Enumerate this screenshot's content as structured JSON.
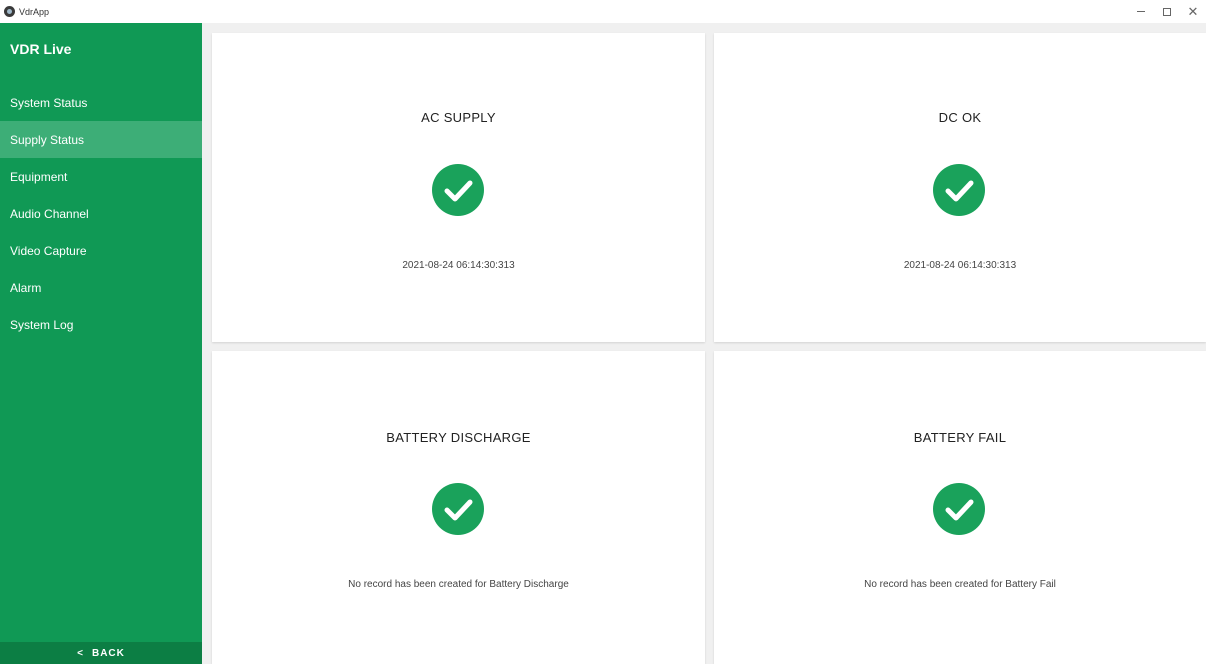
{
  "window": {
    "title": "VdrApp"
  },
  "sidebar": {
    "title": "VDR Live",
    "items": [
      {
        "label": "System Status"
      },
      {
        "label": "Supply Status"
      },
      {
        "label": "Equipment"
      },
      {
        "label": "Audio Channel"
      },
      {
        "label": "Video Capture"
      },
      {
        "label": "Alarm"
      },
      {
        "label": "System Log"
      }
    ],
    "active_item": "Supply Status",
    "back_label": "BACK"
  },
  "cards": [
    {
      "title": "AC SUPPLY",
      "status": "ok",
      "text": "2021-08-24 06:14:30:313"
    },
    {
      "title": "DC OK",
      "status": "ok",
      "text": "2021-08-24 06:14:30:313"
    },
    {
      "title": "BATTERY DISCHARGE",
      "status": "ok",
      "text": "No record has been created for Battery Discharge"
    },
    {
      "title": "BATTERY FAIL",
      "status": "ok",
      "text": "No record has been created for Battery Fail"
    }
  ],
  "colors": {
    "sidebar": "#109955",
    "sidebar_active": "#3dae77",
    "back_bar": "#0c7e44",
    "status_ok": "#1aa25b"
  },
  "icons": {
    "status_ok": "check-circle-icon",
    "back": "chevron-left-icon",
    "window_minimize": "minimize-icon",
    "window_restore": "restore-icon",
    "window_close": "close-icon"
  }
}
